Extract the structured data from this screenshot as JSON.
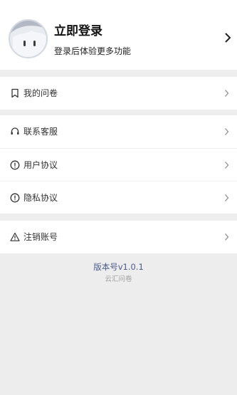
{
  "profile": {
    "title": "立即登录",
    "subtitle": "登录后体验更多功能"
  },
  "groups": [
    {
      "items": [
        {
          "icon": "bookmark-icon",
          "label": "我的问卷"
        }
      ]
    },
    {
      "items": [
        {
          "icon": "headset-icon",
          "label": "联系客服"
        },
        {
          "icon": "info-circle-icon",
          "label": "用户协议"
        },
        {
          "icon": "info-circle-icon",
          "label": "隐私协议"
        }
      ]
    },
    {
      "items": [
        {
          "icon": "warning-triangle-icon",
          "label": "注销账号"
        }
      ]
    }
  ],
  "footer": {
    "version": "版本号v1.0.1",
    "brand": "云汇问卷"
  },
  "colors": {
    "background": "#ededed",
    "card": "#ffffff",
    "version_text": "#4a5b8c"
  }
}
